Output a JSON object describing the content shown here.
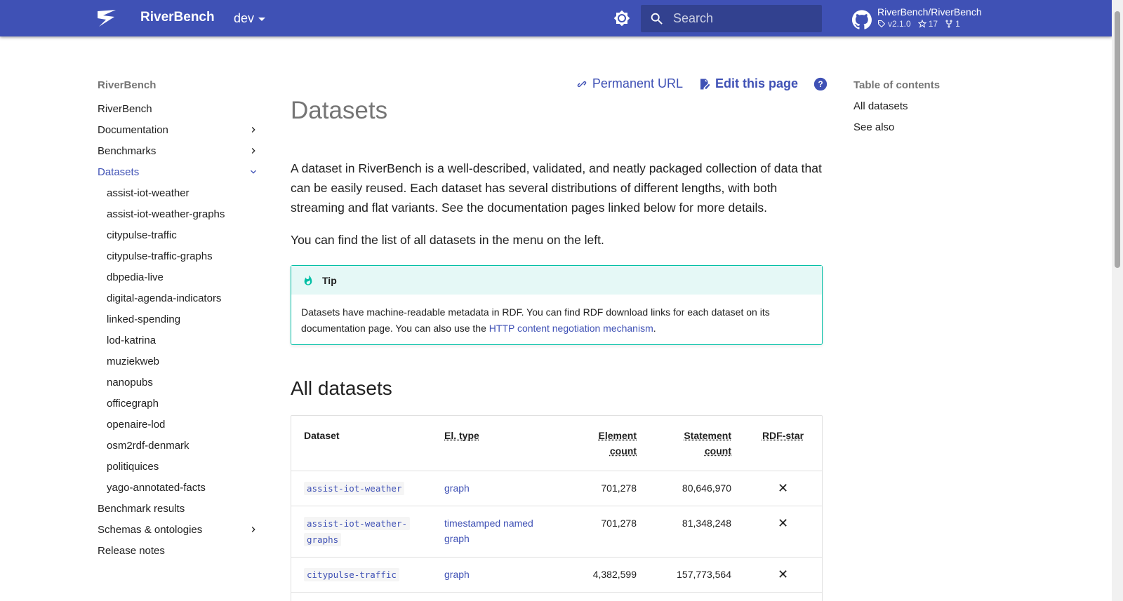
{
  "header": {
    "site_name": "RiverBench",
    "version": "dev",
    "search_placeholder": "Search",
    "repo_name": "RiverBench/RiverBench",
    "repo_tag": "v2.1.0",
    "repo_stars": "17",
    "repo_forks": "1"
  },
  "nav": {
    "title": "RiverBench",
    "items": [
      {
        "label": "RiverBench"
      },
      {
        "label": "Documentation"
      },
      {
        "label": "Benchmarks"
      },
      {
        "label": "Datasets"
      },
      {
        "label": "Benchmark results"
      },
      {
        "label": "Schemas & ontologies"
      },
      {
        "label": "Release notes"
      }
    ],
    "datasets": [
      "assist-iot-weather",
      "assist-iot-weather-graphs",
      "citypulse-traffic",
      "citypulse-traffic-graphs",
      "dbpedia-live",
      "digital-agenda-indicators",
      "linked-spending",
      "lod-katrina",
      "muziekweb",
      "nanopubs",
      "officegraph",
      "openaire-lod",
      "osm2rdf-denmark",
      "politiquices",
      "yago-annotated-facts"
    ]
  },
  "page": {
    "permanent_url": "Permanent URL",
    "edit_page": "Edit this page",
    "title": "Datasets",
    "intro": "A dataset in RiverBench is a well-described, validated, and neatly packaged collection of data that can be easily reused. Each dataset has several distributions of different lengths, with both streaming and flat variants. See the documentation pages linked below for more details.",
    "intro2": "You can find the list of all datasets in the menu on the left.",
    "tip_title": "Tip",
    "tip_text": "Datasets have machine-readable metadata in RDF. You can find RDF download links for each dataset on its documentation page. You can also use the ",
    "tip_link": "HTTP content negotiation mechanism",
    "tip_end": ".",
    "section_title": "All datasets"
  },
  "table": {
    "headers": {
      "dataset": "Dataset",
      "el_type": "El. type",
      "element_count_1": "Element",
      "element_count_2": "count",
      "statement_count_1": "Statement",
      "statement_count_2": "count",
      "rdf_star": "RDF-star"
    },
    "rows": [
      {
        "dataset": "assist-iot-weather",
        "type": "graph",
        "elements": "701,278",
        "statements": "80,646,970",
        "rdfstar": "✕"
      },
      {
        "dataset_1": "assist-iot-weather-",
        "dataset_2": "graphs",
        "type_1": "timestamped named",
        "type_2": "graph",
        "elements": "701,278",
        "statements": "81,348,248",
        "rdfstar": "✕"
      },
      {
        "dataset": "citypulse-traffic",
        "type": "graph",
        "elements": "4,382,599",
        "statements": "157,773,564",
        "rdfstar": "✕"
      }
    ]
  },
  "toc": {
    "title": "Table of contents",
    "items": [
      "All datasets",
      "See also"
    ]
  },
  "colors": {
    "primary": "#3f51b5",
    "tip_border": "#00bfa5",
    "tip_bg": "#e5f8f6"
  }
}
